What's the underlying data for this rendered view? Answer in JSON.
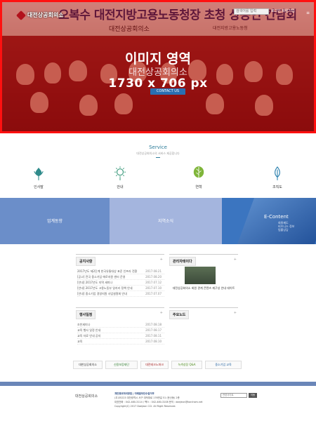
{
  "header": {
    "logo": "대전상공회의소",
    "search_placeholder": "검색어를 입력",
    "top_links": "로그인  회원가입"
  },
  "hero": {
    "banner_text": "오복수 대전지방고용노동청장 초청 상공인 간담회",
    "org_text": "대전상공회의소",
    "sub_org_text": "대전지방고용노동청",
    "placeholder_title": "이미지 영역",
    "placeholder_sub": "대전상공회의소",
    "placeholder_size": "1730 x 706 px",
    "contact_button": "CONTACT US"
  },
  "service": {
    "title": "Service",
    "subtitle": "대전상공회의소의 서비스 제공합니다",
    "items": [
      {
        "label": "인사말",
        "icon": "bloom-icon"
      },
      {
        "label": "안내",
        "icon": "sun-icon"
      },
      {
        "label": "연혁",
        "icon": "leaf-icon"
      },
      {
        "label": "조직도",
        "icon": "sprout-icon"
      }
    ]
  },
  "bands": [
    {
      "label": "업계동향"
    },
    {
      "label": "지역소식"
    },
    {
      "title": "E-Content",
      "items": [
        "회원제도",
        "비즈니스 정보",
        "법률상담"
      ]
    }
  ],
  "boards": {
    "notice": {
      "tab": "공지사항",
      "more": "+",
      "rows": [
        {
          "title": "2017년도 제2단계 한국유통대상 표준 인프라 전환",
          "date": "2017.08.21"
        },
        {
          "title": "[공고] 전국 중소기업 애로지원 센터 운영",
          "date": "2017.08.20"
        },
        {
          "title": "[안내] 2017년도 지역 세미나",
          "date": "2017.07.12"
        },
        {
          "title": "[안내] 2017년도 고용노동부 일자리 정책 안내",
          "date": "2017.07.10"
        },
        {
          "title": "[안내] 중소기업 경영지원 사업설명회 안내",
          "date": "2017.07.07"
        }
      ]
    },
    "news": {
      "tab": "관리자테이다",
      "more": "+",
      "caption": "대전상공회의소 회원 관계 콘텐츠 재구성 안내 데이트"
    },
    "press": {
      "tab": "행사일정",
      "more": "+",
      "rows": [
        {
          "title": "조찬세미나",
          "date": "2017.08.18"
        },
        {
          "title": "교육 행사 일정 안내",
          "date": "2017.08.17"
        },
        {
          "title": "교육 자료 안내 공지",
          "date": "2017.08.11"
        },
        {
          "title": "교육",
          "date": "2017.08.10"
        }
      ]
    },
    "links": {
      "tab": "주요노드",
      "more": "+"
    }
  },
  "partners": [
    "대한상공회의소",
    "신용보증재단",
    "대전테크노파크",
    "녹색성장 Q&A",
    "중소기업 교육"
  ],
  "footer": {
    "logo": "대전상공회의소",
    "line1": "개인정보처리방침 | 이메일무단수집거부",
    "line2": "(우)35223 대전광역시 서구 대덕대로 176번길 51 (둔산동) 2층",
    "line3": "대표전화 : 042-480-3114 / 팩스 : 042-480-3108  문의 : daejeon@korcham.net",
    "line4": "Copyright(C) 2017 Daejeon CCI. All Right Reserved.",
    "select_label": "관련사이트",
    "go_button": "이동"
  }
}
